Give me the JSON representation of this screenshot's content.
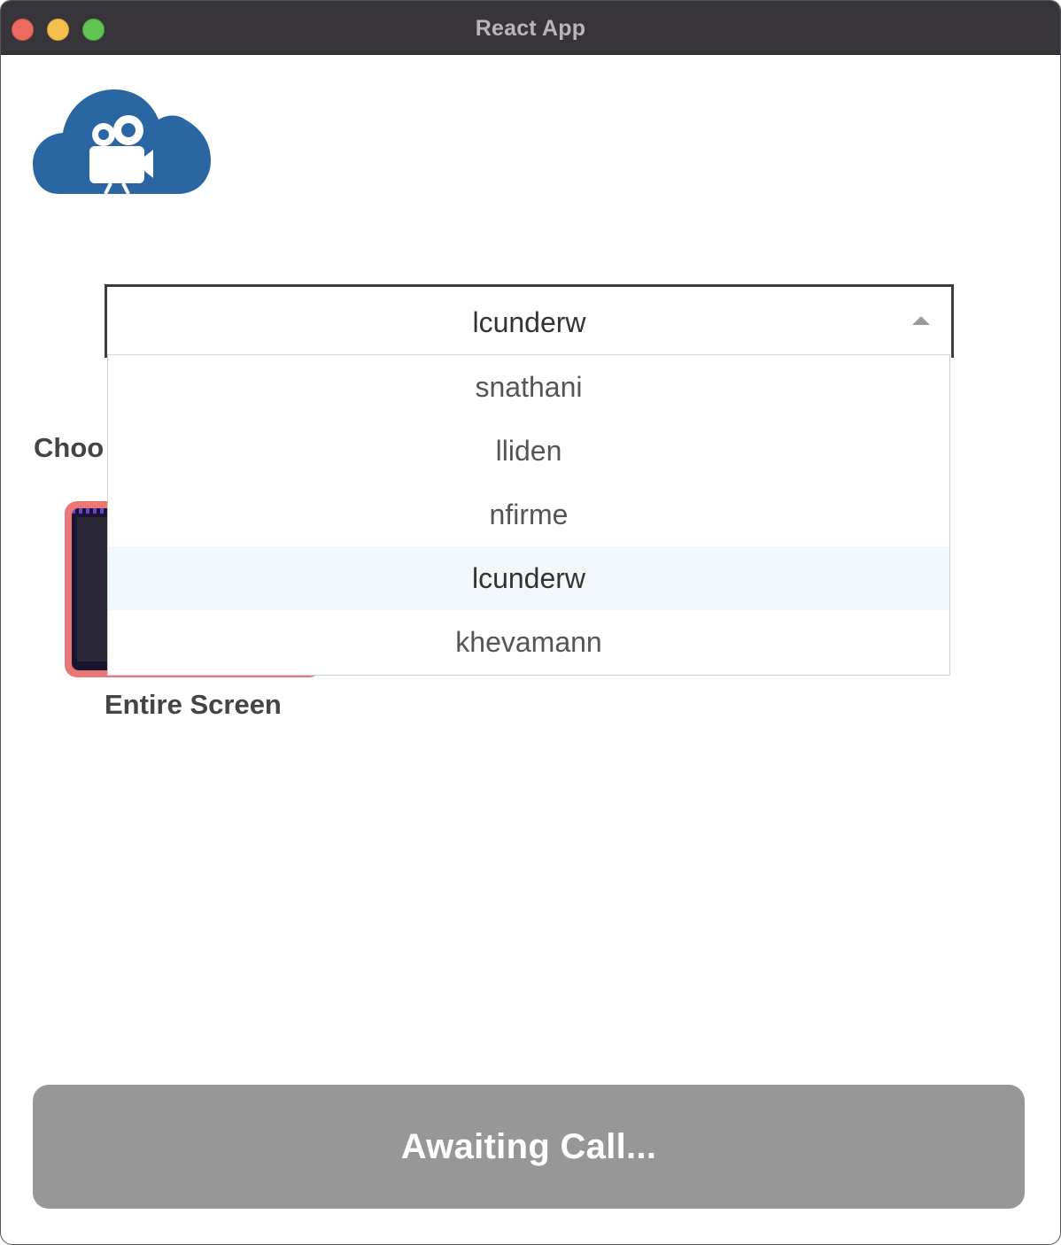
{
  "window": {
    "title": "React App"
  },
  "user_select": {
    "selected_value": "lcunderw",
    "options": [
      "snathani",
      "lliden",
      "nfirme",
      "lcunderw",
      "khevamann"
    ],
    "highlighted_option": "lcunderw"
  },
  "source_picker": {
    "label_visible": "Choo",
    "sources": [
      {
        "label": "Entire Screen"
      }
    ]
  },
  "call_button": {
    "label": "Awaiting Call..."
  },
  "colors": {
    "logo_blue": "#2a67a2",
    "button_gray": "#979797",
    "thumb_border": "#e87775",
    "selected_row": "#f2f7fc"
  },
  "icons": {
    "logo": "cloud-video-camera-icon",
    "select_arrow": "caret-up-icon"
  }
}
